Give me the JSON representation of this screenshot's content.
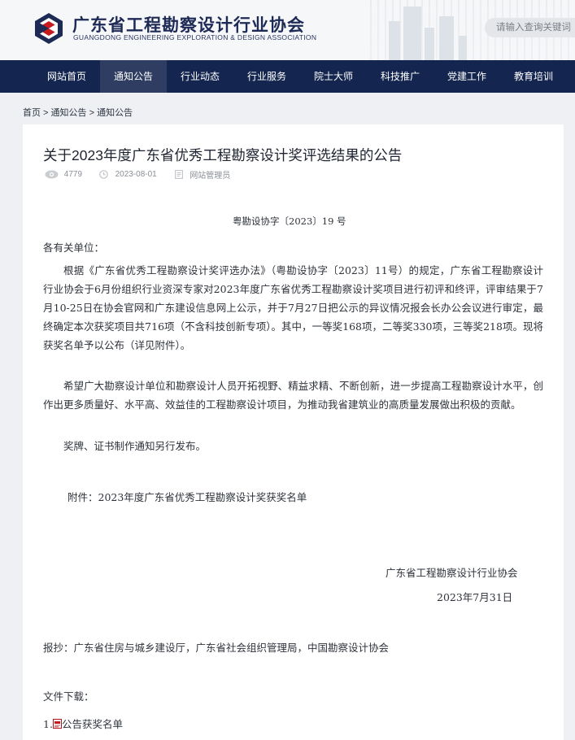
{
  "header": {
    "org_name_cn": "广东省工程勘察设计行业协会",
    "org_name_en": "GUANGDONG ENGINEERING EXPLORATION & DESIGN ASSOCIATION",
    "search_placeholder": "请输入查询关键词"
  },
  "nav": {
    "items": [
      {
        "label": "网站首页"
      },
      {
        "label": "通知公告"
      },
      {
        "label": "行业动态"
      },
      {
        "label": "行业服务"
      },
      {
        "label": "院士大师"
      },
      {
        "label": "科技推广"
      },
      {
        "label": "党建工作"
      },
      {
        "label": "教育培训"
      }
    ],
    "active_index": 1
  },
  "breadcrumb": {
    "home": "首页",
    "sep1": " > ",
    "level1": "通知公告",
    "sep2": " > ",
    "level2": "通知公告"
  },
  "article": {
    "title": "关于2023年度广东省优秀工程勘察设计奖评选结果的公告",
    "views": "4779",
    "date": "2023-08-01",
    "author": "网站管理员",
    "doc_number": "粤勘设协字〔2023〕19 号",
    "salutation": "各有关单位：",
    "paragraphs": [
      "根据《广东省优秀工程勘察设计奖评选办法》（粤勘设协字〔2023〕11号）的规定，广东省工程勘察设计行业协会于6月份组织行业资深专家对2023年度广东省优秀工程勘察设计奖项目进行初评和终评，评审结果于7月10-25日在协会官网和广东建设信息网上公示，并于7月27日把公示的异议情况报会长办公会议进行审定，最终确定本次获奖项目共716项（不含科技创新专项）。其中，一等奖168项，二等奖330项，三等奖218项。现将获奖名单予以公布（详见附件）。",
      "希望广大勘察设计单位和勘察设计人员开拓视野、精益求精、不断创新，进一步提高工程勘察设计水平，创作出更多质量好、水平高、效益佳的工程勘察设计项目，为推动我省建筑业的高质量发展做出积极的贡献。",
      "奖牌、证书制作通知另行发布。"
    ],
    "attachment": "附件：2023年度广东省优秀工程勘察设计奖获奖名单",
    "signature_org": "广东省工程勘察设计行业协会",
    "signature_date": "2023年7月31日",
    "cc": "报抄：广东省住房与城乡建设厅，广东省社会组织管理局，中国勘察设计协会",
    "downloads_label": "文件下载：",
    "downloads": [
      {
        "index": "1.",
        "label": "公告获奖名单"
      }
    ]
  },
  "colors": {
    "nav_bg": "#14264f",
    "nav_active": "#2e3d61",
    "logo_red": "#c8191f",
    "logo_navy": "#1d2a55"
  }
}
